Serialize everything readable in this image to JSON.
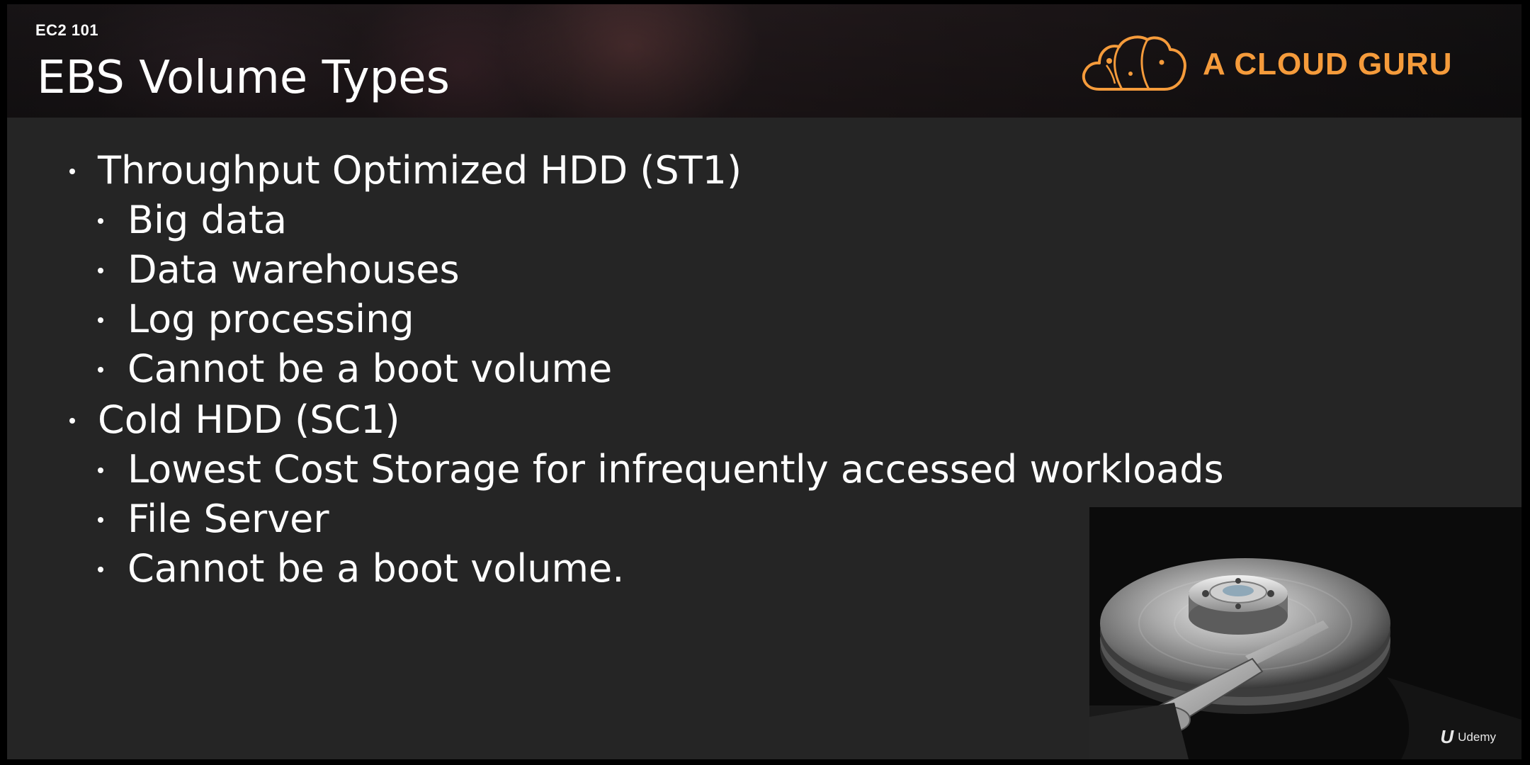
{
  "header": {
    "eyebrow": "EC2 101",
    "title": "EBS Volume Types",
    "brand": "A CLOUD GURU"
  },
  "bullets": [
    {
      "level": 1,
      "text": "Throughput Optimized HDD (ST1)"
    },
    {
      "level": 2,
      "text": "Big data"
    },
    {
      "level": 2,
      "text": "Data warehouses"
    },
    {
      "level": 2,
      "text": "Log processing"
    },
    {
      "level": 2,
      "text": "Cannot be a boot volume"
    },
    {
      "level": 1,
      "text": "Cold HDD (SC1)"
    },
    {
      "level": 2,
      "text": "Lowest Cost Storage for infrequently accessed workloads"
    },
    {
      "level": 2,
      "text": "File Server"
    },
    {
      "level": 2,
      "text": "Cannot be a boot volume."
    }
  ],
  "watermark": {
    "mark": "U",
    "label": "Udemy"
  },
  "colors": {
    "brand": "#f59b3b",
    "slide_bg": "#252525",
    "text": "#ffffff"
  },
  "icons": {
    "logo": "cloud-logo-icon",
    "photo": "hard-drive-photo"
  }
}
